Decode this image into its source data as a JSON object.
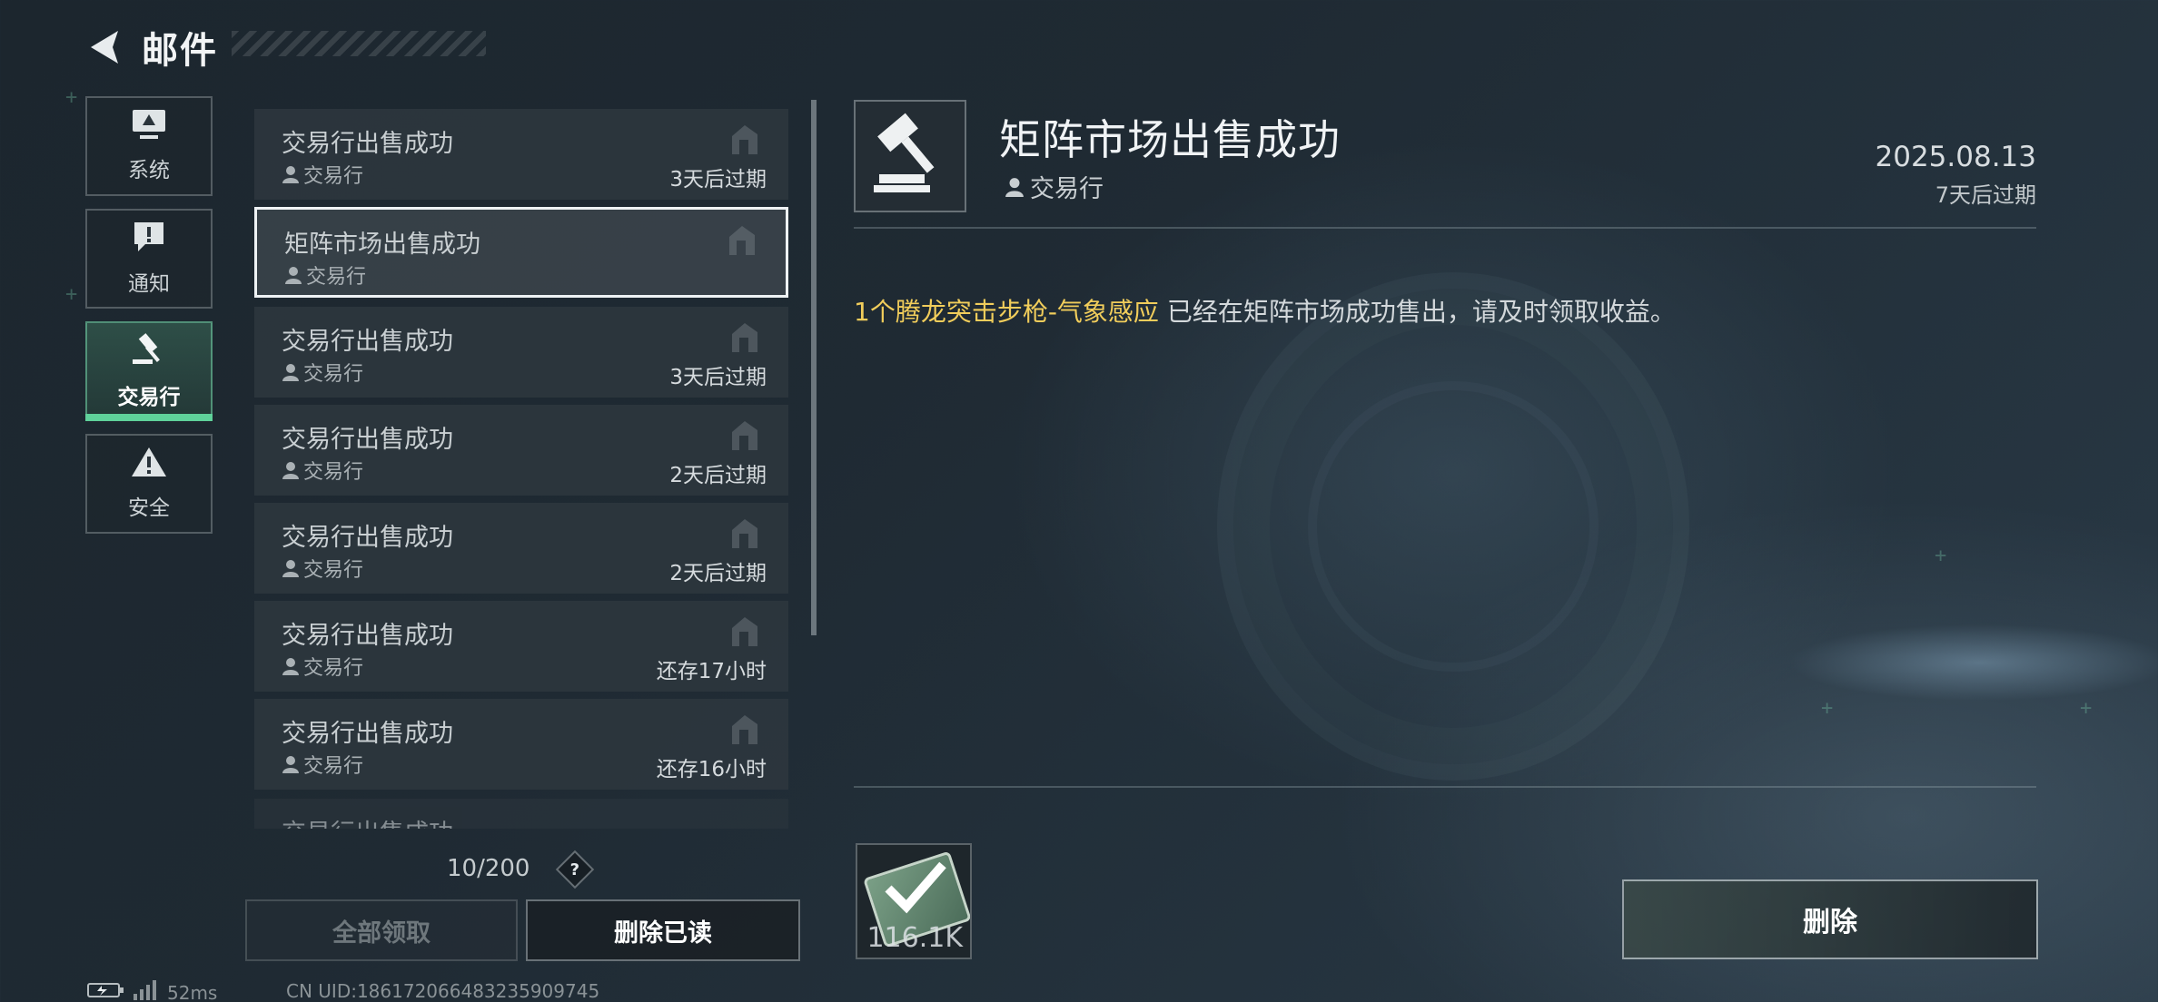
{
  "header": {
    "title": "邮件"
  },
  "categories": [
    {
      "label": "系统",
      "icon": "monitor-icon"
    },
    {
      "label": "通知",
      "icon": "notice-icon"
    },
    {
      "label": "交易行",
      "icon": "gavel-icon",
      "active": true
    },
    {
      "label": "安全",
      "icon": "warning-icon"
    }
  ],
  "mails": [
    {
      "subject": "交易行出售成功",
      "sender": "交易行",
      "expiry": "3天后过期"
    },
    {
      "subject": "矩阵市场出售成功",
      "sender": "交易行",
      "expiry": "",
      "selected": true
    },
    {
      "subject": "交易行出售成功",
      "sender": "交易行",
      "expiry": "3天后过期"
    },
    {
      "subject": "交易行出售成功",
      "sender": "交易行",
      "expiry": "2天后过期"
    },
    {
      "subject": "交易行出售成功",
      "sender": "交易行",
      "expiry": "2天后过期"
    },
    {
      "subject": "交易行出售成功",
      "sender": "交易行",
      "expiry": "还存17小时"
    },
    {
      "subject": "交易行出售成功",
      "sender": "交易行",
      "expiry": "还存16小时"
    },
    {
      "subject": "交易行出售成功",
      "sender": "",
      "expiry": ""
    }
  ],
  "list_footer": {
    "count": "10/200",
    "help": "?",
    "claim_all_label": "全部领取",
    "delete_read_label": "删除已读"
  },
  "status": {
    "ping": "52ms",
    "uid": "CN UID:1861720664832359097​45"
  },
  "detail": {
    "title": "矩阵市场出售成功",
    "sender": "交易行",
    "date": "2025.08.13",
    "expiry": "7天后过期",
    "message_highlight": "1个腾龙突击步枪-气象感应",
    "message_rest": " 已经在矩阵市场成功售出，请及时领取收益。",
    "attachment_qty": "116.1K",
    "delete_label": "删除"
  },
  "colors": {
    "highlight": "#f1cd5b",
    "active_tab": "#5fd19a"
  }
}
